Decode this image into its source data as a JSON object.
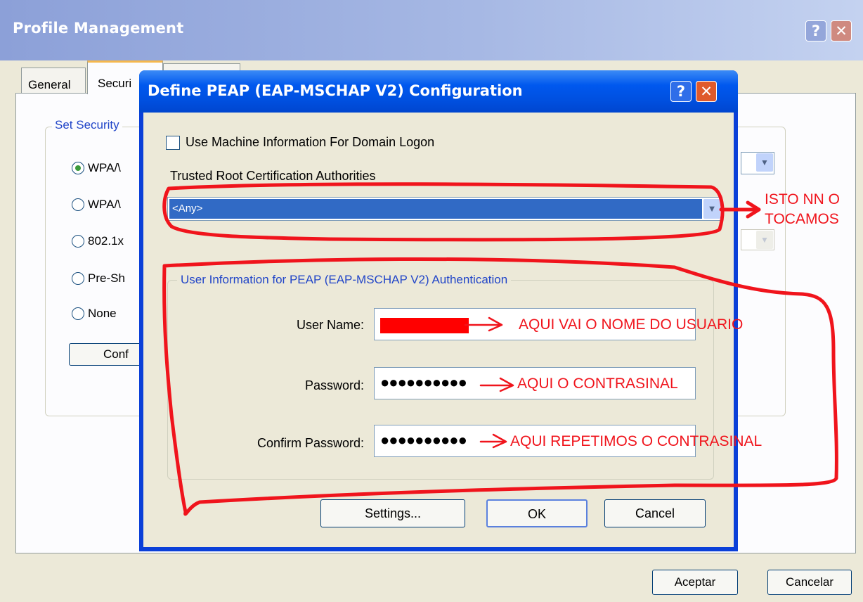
{
  "outer_window": {
    "title": "Profile Management",
    "help_glyph": "?",
    "close_glyph": "✕",
    "tabs": {
      "general": "General",
      "security": "Securi"
    },
    "group_title": "Set Security",
    "radio_options": [
      {
        "label": "WPA/\\",
        "selected": true
      },
      {
        "label": "WPA/\\",
        "selected": false
      },
      {
        "label": "802.1x",
        "selected": false
      },
      {
        "label": "Pre-Sh",
        "selected": false
      },
      {
        "label": "None",
        "selected": false
      }
    ],
    "configure_button": "Conf",
    "aceptar_button": "Aceptar",
    "cancelar_button": "Cancelar"
  },
  "dialog": {
    "title": "Define PEAP (EAP-MSCHAP V2) Configuration",
    "help_glyph": "?",
    "close_glyph": "✕",
    "use_machine_info": {
      "label": "Use Machine Information For Domain Logon",
      "checked": false
    },
    "trusted_ca_label": "Trusted Root Certification Authorities",
    "trusted_ca_value": "<Any>",
    "user_group_title": "User Information for PEAP (EAP-MSCHAP V2) Authentication",
    "user_name_label": "User Name:",
    "password_label": "Password:",
    "password_dots": "●●●●●●●●●●",
    "confirm_password_label": "Confirm Password:",
    "confirm_password_dots": "●●●●●●●●●●",
    "settings_button": "Settings...",
    "ok_button": "OK",
    "cancel_button": "Cancel"
  },
  "annotations": {
    "ca_note_line1": "ISTO NN O",
    "ca_note_line2": "TOCAMOS",
    "user_note": "AQUI VAI O NOME DO USUARIO",
    "password_note": "AQUI O CONTRASINAL",
    "confirm_note": "AQUI REPETIMOS O CONTRASINAL"
  },
  "colors": {
    "annotation_red": "#f0141c",
    "dialog_title_blue": "#0058ee",
    "selection_blue": "#316ac5",
    "window_face": "#ece9d8"
  }
}
